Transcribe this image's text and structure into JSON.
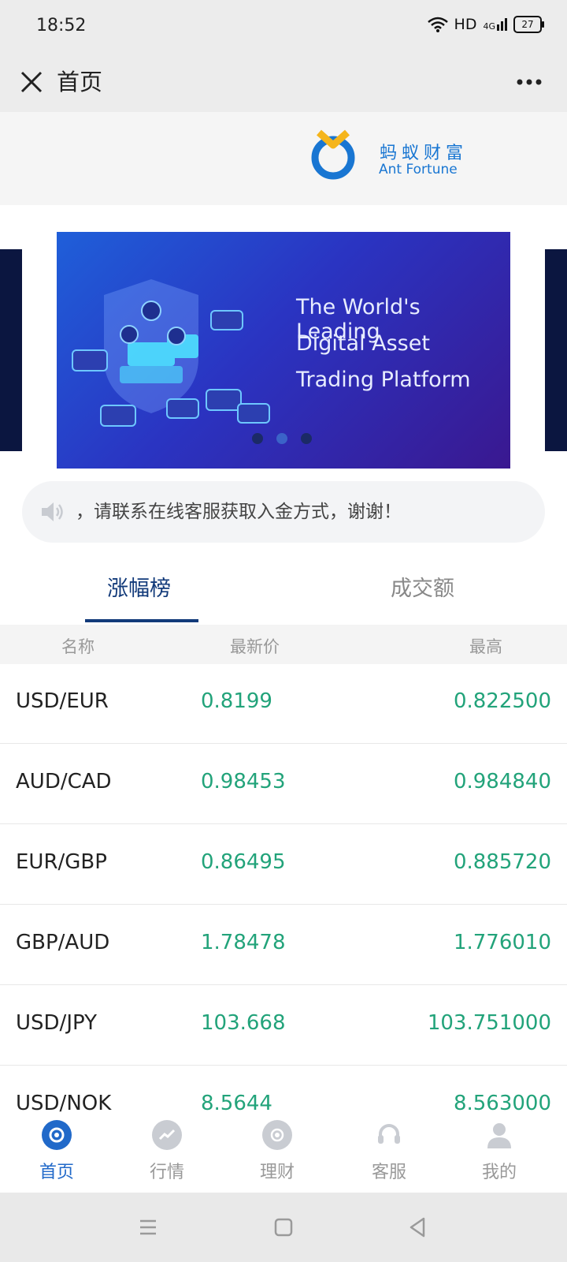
{
  "status_bar": {
    "time": "18:52",
    "network": "HD",
    "signal": "4G",
    "battery": "27"
  },
  "title_bar": {
    "title": "首页"
  },
  "logo": {
    "cn": "蚂蚁财富",
    "en": "Ant Fortune",
    "accent_color": "#1976d2",
    "accent_color_2": "#f5b51b"
  },
  "banner": {
    "lines": [
      "The World's Leading",
      "Digital Asset",
      "Trading Platform"
    ],
    "active_dot": 1
  },
  "notice": {
    "text": "，请联系在线客服获取入金方式，谢谢！"
  },
  "tabs": [
    {
      "label": "涨幅榜",
      "active": true
    },
    {
      "label": "成交额",
      "active": false
    }
  ],
  "table": {
    "headers": {
      "name": "名称",
      "price": "最新价",
      "high": "最高"
    },
    "rows": [
      {
        "name": "USD/EUR",
        "price": "0.8199",
        "high": "0.822500"
      },
      {
        "name": "AUD/CAD",
        "price": "0.98453",
        "high": "0.984840"
      },
      {
        "name": "EUR/GBP",
        "price": "0.86495",
        "high": "0.885720"
      },
      {
        "name": "GBP/AUD",
        "price": "1.78478",
        "high": "1.776010"
      },
      {
        "name": "USD/JPY",
        "price": "103.668",
        "high": "103.751000"
      },
      {
        "name": "USD/NOK",
        "price": "8.5644",
        "high": "8.563000"
      }
    ]
  },
  "bottom_nav": [
    {
      "label": "首页",
      "icon": "home-icon",
      "active": true
    },
    {
      "label": "行情",
      "icon": "market-trend-icon",
      "active": false
    },
    {
      "label": "理财",
      "icon": "finance-icon",
      "active": false
    },
    {
      "label": "客服",
      "icon": "headset-icon",
      "active": false
    },
    {
      "label": "我的",
      "icon": "user-icon",
      "active": false
    }
  ],
  "colors": {
    "up": "#22a37a",
    "tab_active": "#123a7a",
    "nav_active": "#2169c9"
  }
}
